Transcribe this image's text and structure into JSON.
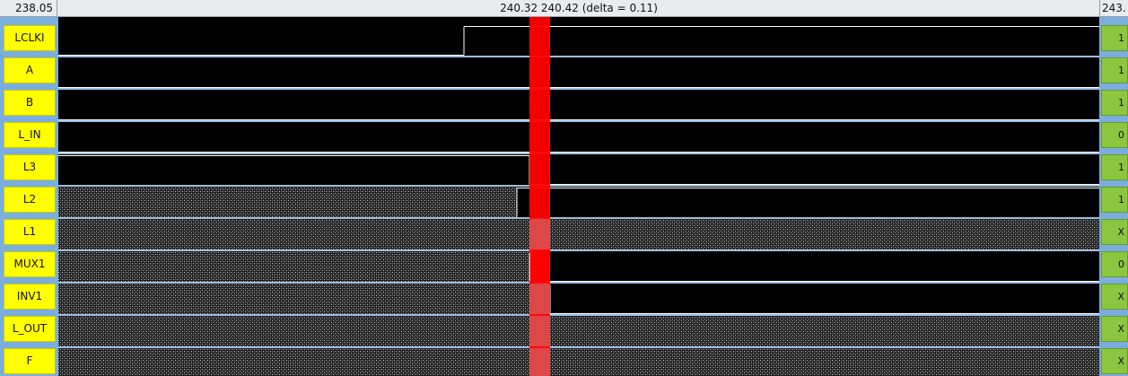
{
  "header": {
    "left_time": "238.05",
    "center_text": "240.32 240.42 (delta = 0.11)",
    "right_time": "243."
  },
  "colors": {
    "wave_bg": "#000000",
    "wave_line": "#ffffff",
    "label_bg": "#ffff00",
    "value_bg": "#8cc63f",
    "cursor": "#ff0000",
    "separator": "#9dbfe0"
  },
  "signals": [
    {
      "name": "LCLKI",
      "value": "1"
    },
    {
      "name": "A",
      "value": "1"
    },
    {
      "name": "B",
      "value": "1"
    },
    {
      "name": "L_IN",
      "value": "0"
    },
    {
      "name": "L3",
      "value": "1"
    },
    {
      "name": "L2",
      "value": "1"
    },
    {
      "name": "L1",
      "value": "X"
    },
    {
      "name": "MUX1",
      "value": "0"
    },
    {
      "name": "INV1",
      "value": "X"
    },
    {
      "name": "L_OUT",
      "value": "X"
    },
    {
      "name": "F",
      "value": "X"
    }
  ]
}
